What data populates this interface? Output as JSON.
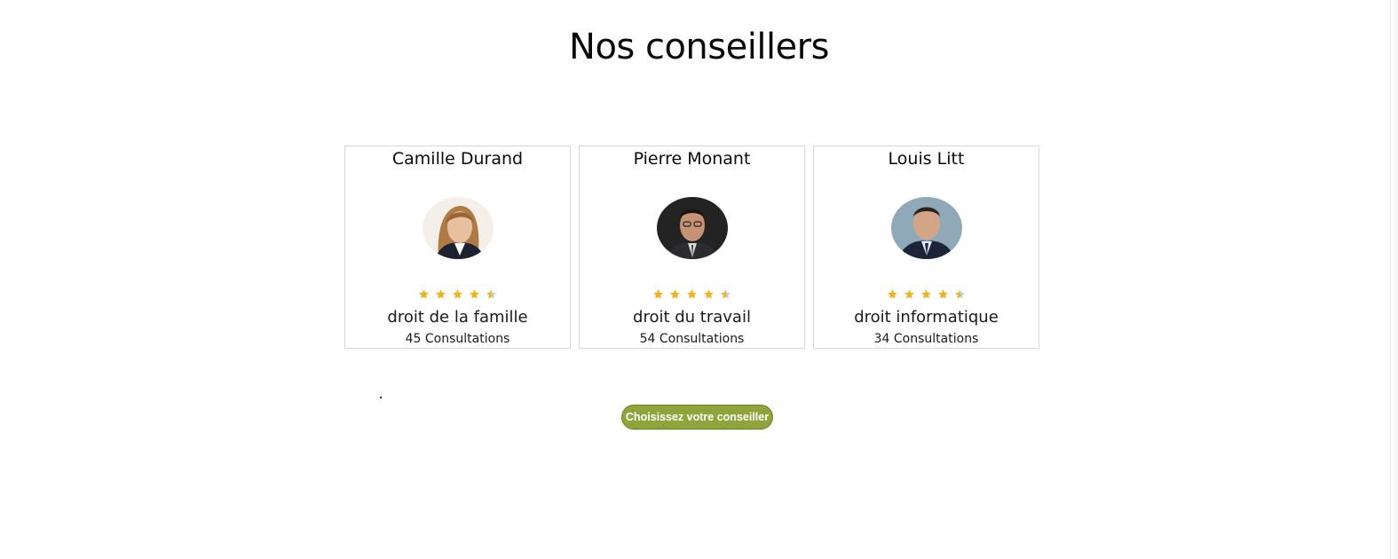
{
  "page": {
    "title": "Nos conseillers"
  },
  "advisors": [
    {
      "name": "Camille Durand",
      "rating": 4.5,
      "rating_max": 5,
      "specialty": "droit de la famille",
      "consultations": "45 Consultations"
    },
    {
      "name": "Pierre Monant",
      "rating": 4.5,
      "rating_max": 5,
      "specialty": "droit du travail",
      "consultations": "54 Consultations"
    },
    {
      "name": "Louis Litt",
      "rating": 4.5,
      "rating_max": 5,
      "specialty": "droit informatique",
      "consultations": "34 Consultations"
    }
  ],
  "cta": {
    "label": "Choisissez votre conseiller"
  },
  "colors": {
    "star": "#f2b21c",
    "star_empty": "#c9c9c9",
    "cta_background": "#8fa43a"
  },
  "icons": {
    "star": "star-icon"
  }
}
